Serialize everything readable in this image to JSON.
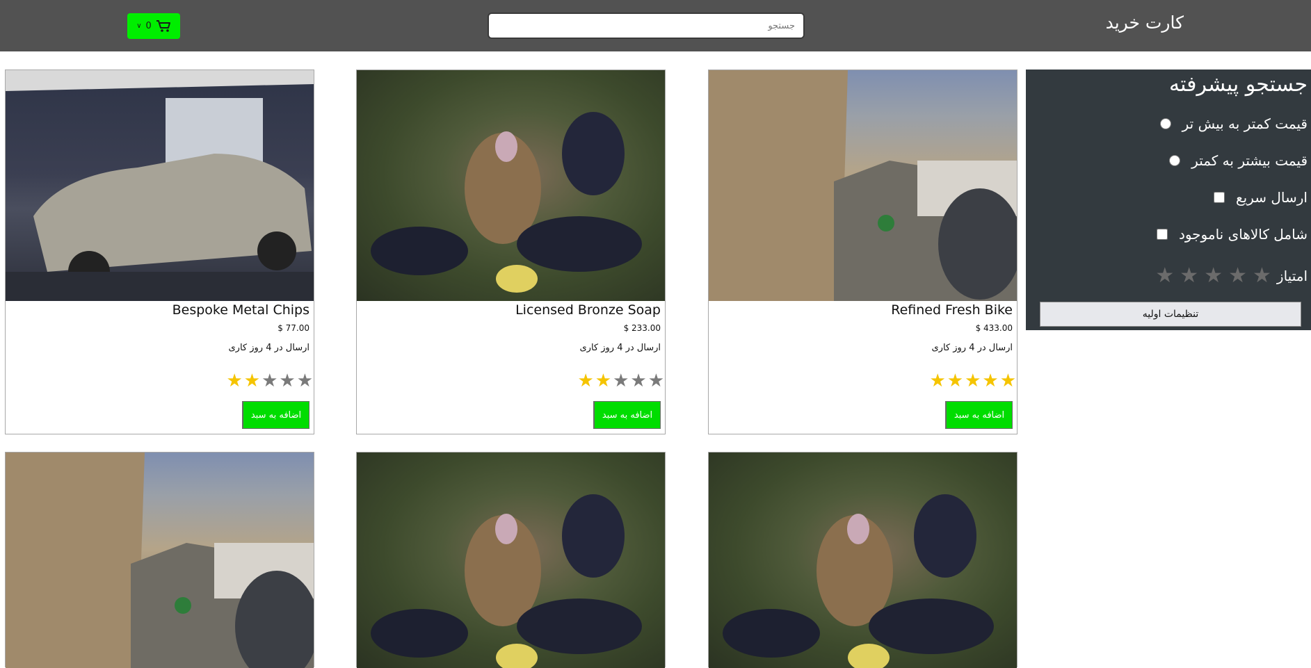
{
  "header": {
    "title": "کارت خرید",
    "search_placeholder": "جستجو",
    "cart_count": "0"
  },
  "sidebar": {
    "title": "جستجو پیشرفته",
    "sort_low_high": "قیمت کمتر به بیش تر",
    "sort_high_low": "قیمت بیشتر به کمتر",
    "fast_shipping": "ارسال سریع",
    "include_out_of_stock": "شامل کالاهای ناموجود",
    "rating_label": "امتیاز",
    "rating_value": 0,
    "reset_label": "تنظیمات اولیه"
  },
  "products": [
    {
      "name": "Refined Fresh Bike",
      "price": "$ 433.00",
      "shipping": "ارسال در 4 روز کاری",
      "rating": 5,
      "image": "street-cats-photo",
      "button": "اضافه به سبد"
    },
    {
      "name": "Licensed Bronze Soap",
      "price": "$ 233.00",
      "shipping": "ارسال در 4 روز کاری",
      "rating": 2,
      "image": "vulture-crows-photo",
      "button": "اضافه به سبد"
    },
    {
      "name": "Bespoke Metal Chips",
      "price": "$ 77.00",
      "shipping": "ارسال در 4 روز کاری",
      "rating": 2,
      "image": "silver-car-photo",
      "button": "اضافه به سبد"
    },
    {
      "image": "vulture-crows-photo"
    },
    {
      "image": "vulture-crows-photo"
    },
    {
      "image": "street-cats-photo"
    }
  ]
}
